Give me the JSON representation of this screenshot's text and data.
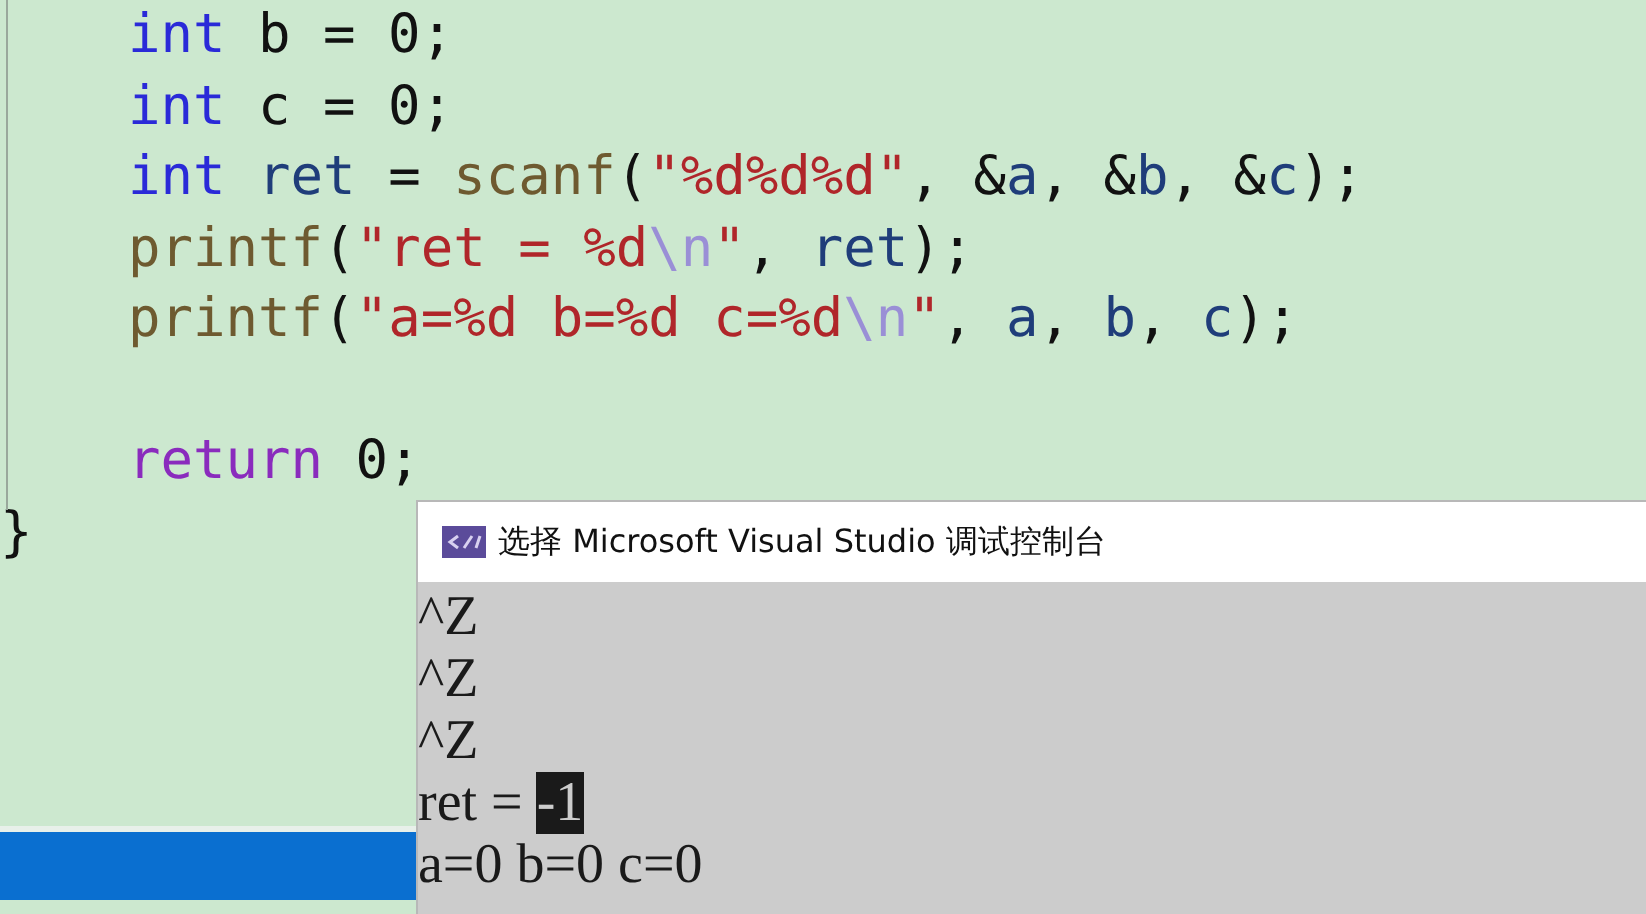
{
  "editor": {
    "lines": [
      {
        "kind": "statement",
        "tokens": [
          {
            "text": "int",
            "kind": "keyword"
          },
          {
            "text": " b = 0;",
            "kind": "plain"
          }
        ]
      },
      {
        "kind": "statement",
        "tokens": [
          {
            "text": "int",
            "kind": "keyword"
          },
          {
            "text": " c = 0;",
            "kind": "plain"
          }
        ]
      },
      {
        "kind": "statement",
        "tokens": [
          {
            "text": "int ",
            "kind": "keyword"
          },
          {
            "text": "ret",
            "kind": "variable"
          },
          {
            "text": " = ",
            "kind": "plain"
          },
          {
            "text": "scanf",
            "kind": "function"
          },
          {
            "text": "(",
            "kind": "plain"
          },
          {
            "text": "\"%d%d%d\"",
            "kind": "string"
          },
          {
            "text": ", &",
            "kind": "plain"
          },
          {
            "text": "a",
            "kind": "variable"
          },
          {
            "text": ", &",
            "kind": "plain"
          },
          {
            "text": "b",
            "kind": "variable"
          },
          {
            "text": ", &",
            "kind": "plain"
          },
          {
            "text": "c",
            "kind": "variable"
          },
          {
            "text": ");",
            "kind": "plain"
          }
        ]
      },
      {
        "kind": "statement",
        "tokens": [
          {
            "text": "printf",
            "kind": "function"
          },
          {
            "text": "(",
            "kind": "plain"
          },
          {
            "text": "\"ret = %d",
            "kind": "string"
          },
          {
            "text": "\\n",
            "kind": "escape"
          },
          {
            "text": "\"",
            "kind": "string"
          },
          {
            "text": ", ",
            "kind": "plain"
          },
          {
            "text": "ret",
            "kind": "variable"
          },
          {
            "text": ");",
            "kind": "plain"
          }
        ]
      },
      {
        "kind": "statement",
        "tokens": [
          {
            "text": "printf",
            "kind": "function"
          },
          {
            "text": "(",
            "kind": "plain"
          },
          {
            "text": "\"a=%d b=%d c=%d",
            "kind": "string"
          },
          {
            "text": "\\n",
            "kind": "escape"
          },
          {
            "text": "\"",
            "kind": "string"
          },
          {
            "text": ", ",
            "kind": "plain"
          },
          {
            "text": "a",
            "kind": "variable"
          },
          {
            "text": ", ",
            "kind": "plain"
          },
          {
            "text": "b",
            "kind": "variable"
          },
          {
            "text": ", ",
            "kind": "plain"
          },
          {
            "text": "c",
            "kind": "variable"
          },
          {
            "text": ");",
            "kind": "plain"
          }
        ]
      },
      {
        "kind": "blank"
      },
      {
        "kind": "statement",
        "tokens": [
          {
            "text": "return",
            "kind": "control"
          },
          {
            "text": " 0;",
            "kind": "plain"
          }
        ]
      },
      {
        "kind": "brace",
        "tokens": [
          {
            "text": "}",
            "kind": "plain"
          }
        ]
      }
    ]
  },
  "console": {
    "title": "选择 Microsoft Visual Studio 调试控制台",
    "lines": [
      [
        {
          "text": "^Z",
          "selected": false
        }
      ],
      [
        {
          "text": "^Z",
          "selected": false
        }
      ],
      [
        {
          "text": "^Z",
          "selected": false
        }
      ],
      [
        {
          "text": "ret = ",
          "selected": false
        },
        {
          "text": "-1",
          "selected": true
        }
      ],
      [
        {
          "text": "a=0 b=0 c=0",
          "selected": false
        }
      ]
    ]
  }
}
